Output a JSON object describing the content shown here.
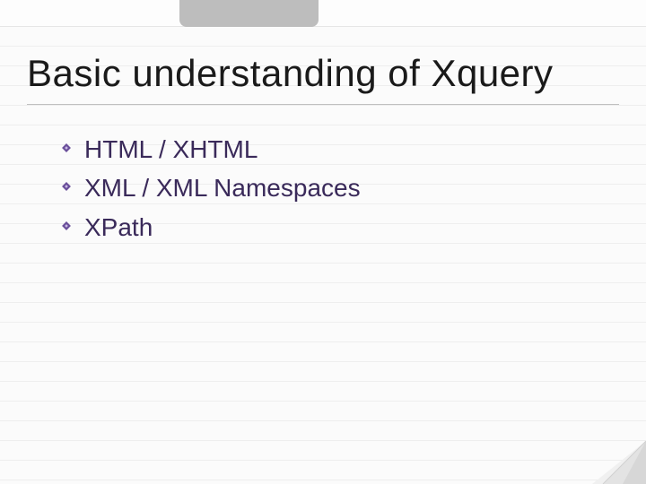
{
  "slide": {
    "title": "Basic understanding of Xquery",
    "bullets": [
      {
        "label": "HTML / XHTML"
      },
      {
        "label": "XML / XML Namespaces"
      },
      {
        "label": "XPath"
      }
    ]
  },
  "theme": {
    "bullet_color": "#6a4f9a",
    "text_color": "#3a2a5a",
    "title_color": "#1a1a1a"
  }
}
